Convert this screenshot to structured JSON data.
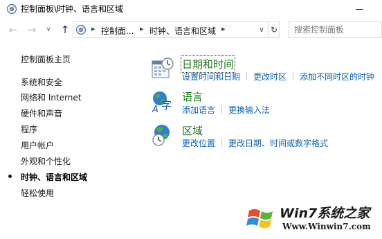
{
  "window": {
    "title": "控制面板\\时钟、语言和区域"
  },
  "navbar": {
    "back_icon": "back-arrow-icon",
    "forward_icon": "forward-arrow-icon",
    "recent_icon": "chevron-down-icon",
    "up_icon": "up-arrow-icon",
    "breadcrumbs": [
      "控制面...",
      "时钟、语言和区域"
    ],
    "search_placeholder": "搜索控制面板"
  },
  "sidebar": {
    "items": [
      {
        "label": "控制面板主页"
      },
      {
        "label": "系统和安全"
      },
      {
        "label": "网络和 Internet"
      },
      {
        "label": "硬件和声音"
      },
      {
        "label": "程序"
      },
      {
        "label": "用户帐户"
      },
      {
        "label": "外观和个性化"
      },
      {
        "label": "时钟、语言和区域",
        "current": true
      },
      {
        "label": "轻松使用"
      }
    ]
  },
  "categories": [
    {
      "title": "日期和时间",
      "icon": "calendar-clock-icon",
      "links": [
        "设置时间和日期",
        "更改时区",
        "添加不同时区的时钟"
      ]
    },
    {
      "title": "语言",
      "icon": "language-icon",
      "links": [
        "添加语言",
        "更换输入法"
      ]
    },
    {
      "title": "区域",
      "icon": "globe-clock-icon",
      "links": [
        "更改位置",
        "更改日期、时间或数字格式"
      ]
    }
  ],
  "watermark": {
    "title": "Win7系统之家",
    "url": "Www.Winwin7.com"
  },
  "colors": {
    "category_title": "#1e7a1e",
    "link": "#0a63b8"
  }
}
